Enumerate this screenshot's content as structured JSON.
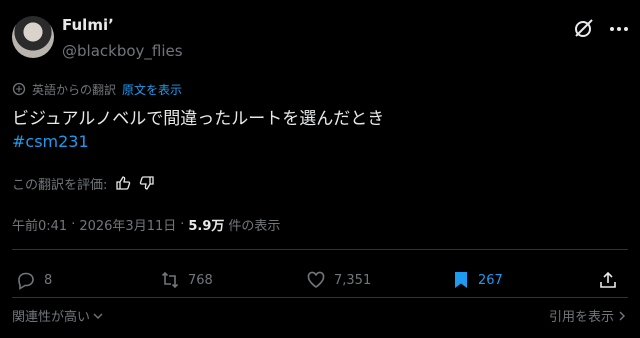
{
  "author": {
    "display_name": "Fulmiʼ",
    "handle": "@blackboy_flies"
  },
  "translation": {
    "label": "英語からの翻訳",
    "show_original": "原文を表示"
  },
  "tweet": {
    "text": "ビジュアルノベルで間違ったルートを選んだとき",
    "hashtag": "#csm231"
  },
  "rate": {
    "label": "この翻訳を評価:"
  },
  "meta": {
    "time": "午前0:41",
    "sep1": "·",
    "date": "2026年3月11日",
    "sep2": "·",
    "views": "5.9万",
    "views_label": "件の表示"
  },
  "actions": {
    "replies": "8",
    "reposts": "768",
    "likes": "7,351",
    "bookmarks": "267"
  },
  "footer": {
    "sort": "関連性が高い",
    "quotes": "引用を表示"
  },
  "colors": {
    "accent": "#1d9bf0",
    "muted": "#71767b",
    "text": "#e7e9ea",
    "background": "#000000"
  },
  "icons": [
    "grok-icon",
    "more-icon",
    "translate-icon",
    "thumbs-up-icon",
    "thumbs-down-icon",
    "reply-icon",
    "repost-icon",
    "like-icon",
    "bookmark-icon",
    "share-icon",
    "chevron-down-icon",
    "chevron-right-icon"
  ]
}
